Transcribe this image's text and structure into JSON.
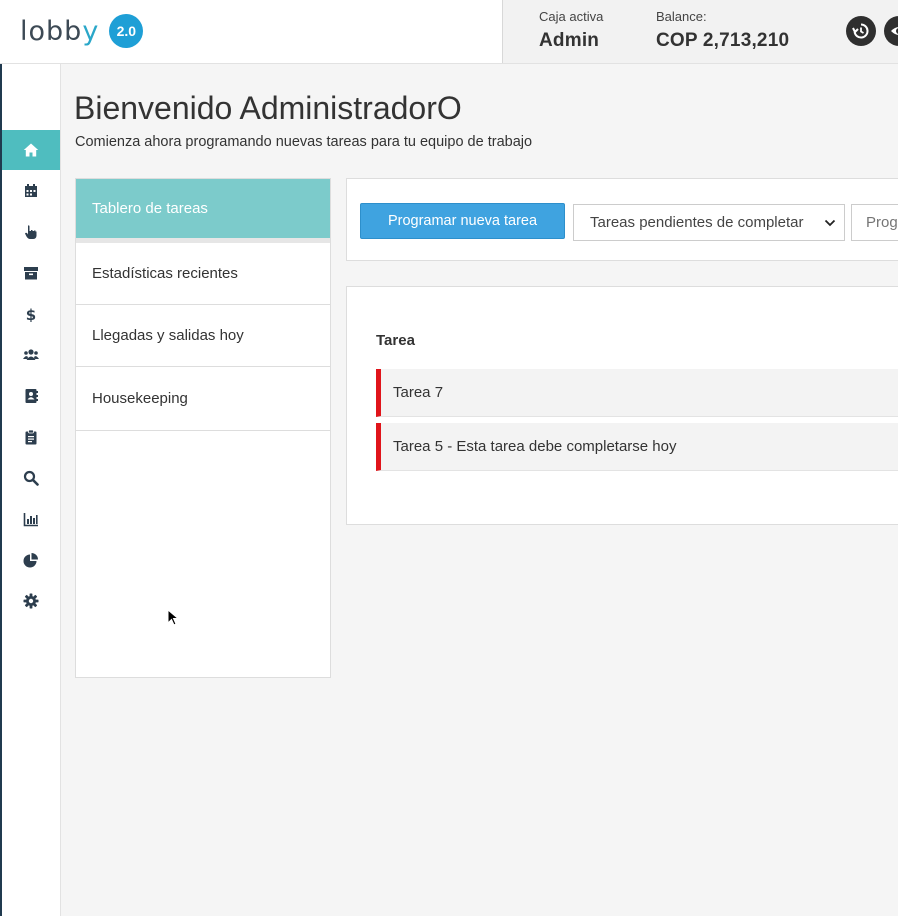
{
  "app": {
    "logo_text": "lobby",
    "version": "2.0"
  },
  "account": {
    "caja_label": "Caja activa",
    "caja_value": "Admin",
    "balance_label": "Balance:",
    "balance_value": "COP 2,713,210"
  },
  "header_actions": [
    {
      "icon": "history-icon"
    },
    {
      "icon": "eye-icon"
    }
  ],
  "sidebar": {
    "items": [
      {
        "icon": "home-icon",
        "active": true
      },
      {
        "icon": "calendar-icon"
      },
      {
        "icon": "hand-pointer-icon"
      },
      {
        "icon": "archive-icon"
      },
      {
        "icon": "dollar-icon"
      },
      {
        "icon": "users-icon"
      },
      {
        "icon": "address-book-icon"
      },
      {
        "icon": "clipboard-icon"
      },
      {
        "icon": "search-icon"
      },
      {
        "icon": "bar-chart-icon"
      },
      {
        "icon": "pie-chart-icon"
      },
      {
        "icon": "gear-icon"
      }
    ]
  },
  "page": {
    "title": "Bienvenido AdministradorO",
    "subtitle": "Comienza ahora programando nuevas tareas para tu equipo de trabajo"
  },
  "menu": {
    "items": [
      {
        "label": "Tablero de tareas",
        "active": true
      },
      {
        "label": "Estadísticas recientes"
      },
      {
        "label": "Llegadas y salidas hoy"
      },
      {
        "label": "Housekeeping"
      }
    ]
  },
  "toolbar": {
    "new_task_label": "Programar nueva tarea",
    "filter_selected": "Tareas pendientes de completar",
    "search_placeholder": "Programadas"
  },
  "tasks": {
    "header": "Tarea",
    "rows": [
      {
        "label": "Tarea 7",
        "status_color": "#e0141a"
      },
      {
        "label": "Tarea 5 - Esta tarea debe completarse hoy",
        "status_color": "#e0141a"
      }
    ]
  },
  "colors": {
    "accent_teal": "#4fbdbf",
    "menu_active": "#7ccbcb",
    "primary_button": "#3fa3e0",
    "badge": "#1e9fd6",
    "task_flag": "#e0141a"
  }
}
